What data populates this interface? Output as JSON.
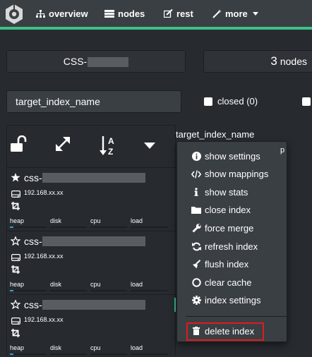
{
  "nav": {
    "overview": "overview",
    "nodes": "nodes",
    "rest": "rest",
    "more": "more"
  },
  "summary": {
    "cluster_name_prefix": "CSS-",
    "nodes_count": "3",
    "nodes_label": "nodes"
  },
  "filter": {
    "index_filter_value": "target_index_name",
    "closed_label": "closed (0)"
  },
  "table": {
    "index_header": "target_index_name",
    "nodes": [
      {
        "name_prefix": "css-",
        "ip": "192.168.xx.xx",
        "master": true,
        "metrics": [
          {
            "label": "heap",
            "fill": 0.1
          },
          {
            "label": "disk",
            "fill": 0.0
          },
          {
            "label": "cpu",
            "fill": 0.0
          },
          {
            "label": "load",
            "fill": 0.0
          }
        ]
      },
      {
        "name_prefix": "css-",
        "ip": "192.168.xx.xx",
        "master": false,
        "metrics": [
          {
            "label": "heap",
            "fill": 0.1
          },
          {
            "label": "disk",
            "fill": 0.0
          },
          {
            "label": "cpu",
            "fill": 0.0
          },
          {
            "label": "load",
            "fill": 0.0
          }
        ]
      },
      {
        "name_prefix": "css-",
        "ip": "192.168.xx.xx",
        "master": false,
        "metrics": [
          {
            "label": "heap",
            "fill": 0.1
          },
          {
            "label": "disk",
            "fill": 0.0
          },
          {
            "label": "cpu",
            "fill": 0.0
          },
          {
            "label": "load",
            "fill": 0.0
          }
        ]
      }
    ]
  },
  "menu": {
    "items": [
      {
        "label": "show settings",
        "icon": "info-circle-icon"
      },
      {
        "label": "show mappings",
        "icon": "code-icon"
      },
      {
        "label": "show stats",
        "icon": "info-icon"
      },
      {
        "label": "close index",
        "icon": "folder-icon"
      },
      {
        "label": "force merge",
        "icon": "wrench-icon"
      },
      {
        "label": "refresh index",
        "icon": "refresh-icon"
      },
      {
        "label": "flush index",
        "icon": "flush-icon"
      },
      {
        "label": "clear cache",
        "icon": "circle-icon"
      },
      {
        "label": "index settings",
        "icon": "gear-icon"
      }
    ],
    "delete": {
      "label": "delete index",
      "icon": "trash-icon"
    }
  },
  "colors": {
    "navbar": "#3a3f44",
    "accent": "#3ebf86",
    "background": "#272b30",
    "highlight_border": "#e01b1b",
    "metric_fill": "#2a9fd6"
  }
}
